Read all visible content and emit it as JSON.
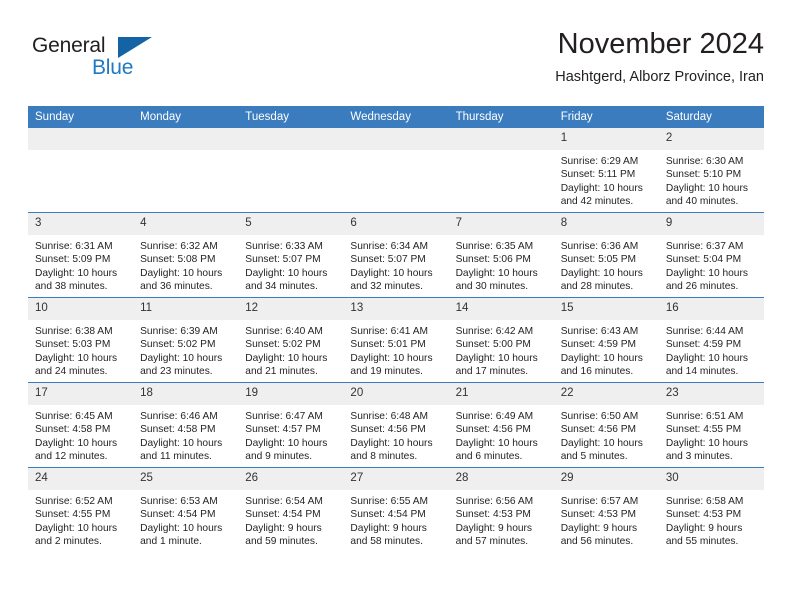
{
  "brand": {
    "name_top": "General",
    "name_bottom": "Blue"
  },
  "header": {
    "title": "November 2024",
    "location": "Hashtgerd, Alborz Province, Iran"
  },
  "colors": {
    "header_blue": "#3a7cbe",
    "brand_blue": "#1f7ac4",
    "daynum_bg": "#efeff0",
    "text": "#231f20"
  },
  "weekdays": [
    "Sunday",
    "Monday",
    "Tuesday",
    "Wednesday",
    "Thursday",
    "Friday",
    "Saturday"
  ],
  "weeks": [
    [
      {
        "day": "",
        "empty": true
      },
      {
        "day": "",
        "empty": true
      },
      {
        "day": "",
        "empty": true
      },
      {
        "day": "",
        "empty": true
      },
      {
        "day": "",
        "empty": true
      },
      {
        "day": "1",
        "sunrise": "Sunrise: 6:29 AM",
        "sunset": "Sunset: 5:11 PM",
        "daylight": "Daylight: 10 hours and 42 minutes."
      },
      {
        "day": "2",
        "sunrise": "Sunrise: 6:30 AM",
        "sunset": "Sunset: 5:10 PM",
        "daylight": "Daylight: 10 hours and 40 minutes."
      }
    ],
    [
      {
        "day": "3",
        "sunrise": "Sunrise: 6:31 AM",
        "sunset": "Sunset: 5:09 PM",
        "daylight": "Daylight: 10 hours and 38 minutes."
      },
      {
        "day": "4",
        "sunrise": "Sunrise: 6:32 AM",
        "sunset": "Sunset: 5:08 PM",
        "daylight": "Daylight: 10 hours and 36 minutes."
      },
      {
        "day": "5",
        "sunrise": "Sunrise: 6:33 AM",
        "sunset": "Sunset: 5:07 PM",
        "daylight": "Daylight: 10 hours and 34 minutes."
      },
      {
        "day": "6",
        "sunrise": "Sunrise: 6:34 AM",
        "sunset": "Sunset: 5:07 PM",
        "daylight": "Daylight: 10 hours and 32 minutes."
      },
      {
        "day": "7",
        "sunrise": "Sunrise: 6:35 AM",
        "sunset": "Sunset: 5:06 PM",
        "daylight": "Daylight: 10 hours and 30 minutes."
      },
      {
        "day": "8",
        "sunrise": "Sunrise: 6:36 AM",
        "sunset": "Sunset: 5:05 PM",
        "daylight": "Daylight: 10 hours and 28 minutes."
      },
      {
        "day": "9",
        "sunrise": "Sunrise: 6:37 AM",
        "sunset": "Sunset: 5:04 PM",
        "daylight": "Daylight: 10 hours and 26 minutes."
      }
    ],
    [
      {
        "day": "10",
        "sunrise": "Sunrise: 6:38 AM",
        "sunset": "Sunset: 5:03 PM",
        "daylight": "Daylight: 10 hours and 24 minutes."
      },
      {
        "day": "11",
        "sunrise": "Sunrise: 6:39 AM",
        "sunset": "Sunset: 5:02 PM",
        "daylight": "Daylight: 10 hours and 23 minutes."
      },
      {
        "day": "12",
        "sunrise": "Sunrise: 6:40 AM",
        "sunset": "Sunset: 5:02 PM",
        "daylight": "Daylight: 10 hours and 21 minutes."
      },
      {
        "day": "13",
        "sunrise": "Sunrise: 6:41 AM",
        "sunset": "Sunset: 5:01 PM",
        "daylight": "Daylight: 10 hours and 19 minutes."
      },
      {
        "day": "14",
        "sunrise": "Sunrise: 6:42 AM",
        "sunset": "Sunset: 5:00 PM",
        "daylight": "Daylight: 10 hours and 17 minutes."
      },
      {
        "day": "15",
        "sunrise": "Sunrise: 6:43 AM",
        "sunset": "Sunset: 4:59 PM",
        "daylight": "Daylight: 10 hours and 16 minutes."
      },
      {
        "day": "16",
        "sunrise": "Sunrise: 6:44 AM",
        "sunset": "Sunset: 4:59 PM",
        "daylight": "Daylight: 10 hours and 14 minutes."
      }
    ],
    [
      {
        "day": "17",
        "sunrise": "Sunrise: 6:45 AM",
        "sunset": "Sunset: 4:58 PM",
        "daylight": "Daylight: 10 hours and 12 minutes."
      },
      {
        "day": "18",
        "sunrise": "Sunrise: 6:46 AM",
        "sunset": "Sunset: 4:58 PM",
        "daylight": "Daylight: 10 hours and 11 minutes."
      },
      {
        "day": "19",
        "sunrise": "Sunrise: 6:47 AM",
        "sunset": "Sunset: 4:57 PM",
        "daylight": "Daylight: 10 hours and 9 minutes."
      },
      {
        "day": "20",
        "sunrise": "Sunrise: 6:48 AM",
        "sunset": "Sunset: 4:56 PM",
        "daylight": "Daylight: 10 hours and 8 minutes."
      },
      {
        "day": "21",
        "sunrise": "Sunrise: 6:49 AM",
        "sunset": "Sunset: 4:56 PM",
        "daylight": "Daylight: 10 hours and 6 minutes."
      },
      {
        "day": "22",
        "sunrise": "Sunrise: 6:50 AM",
        "sunset": "Sunset: 4:56 PM",
        "daylight": "Daylight: 10 hours and 5 minutes."
      },
      {
        "day": "23",
        "sunrise": "Sunrise: 6:51 AM",
        "sunset": "Sunset: 4:55 PM",
        "daylight": "Daylight: 10 hours and 3 minutes."
      }
    ],
    [
      {
        "day": "24",
        "sunrise": "Sunrise: 6:52 AM",
        "sunset": "Sunset: 4:55 PM",
        "daylight": "Daylight: 10 hours and 2 minutes."
      },
      {
        "day": "25",
        "sunrise": "Sunrise: 6:53 AM",
        "sunset": "Sunset: 4:54 PM",
        "daylight": "Daylight: 10 hours and 1 minute."
      },
      {
        "day": "26",
        "sunrise": "Sunrise: 6:54 AM",
        "sunset": "Sunset: 4:54 PM",
        "daylight": "Daylight: 9 hours and 59 minutes."
      },
      {
        "day": "27",
        "sunrise": "Sunrise: 6:55 AM",
        "sunset": "Sunset: 4:54 PM",
        "daylight": "Daylight: 9 hours and 58 minutes."
      },
      {
        "day": "28",
        "sunrise": "Sunrise: 6:56 AM",
        "sunset": "Sunset: 4:53 PM",
        "daylight": "Daylight: 9 hours and 57 minutes."
      },
      {
        "day": "29",
        "sunrise": "Sunrise: 6:57 AM",
        "sunset": "Sunset: 4:53 PM",
        "daylight": "Daylight: 9 hours and 56 minutes."
      },
      {
        "day": "30",
        "sunrise": "Sunrise: 6:58 AM",
        "sunset": "Sunset: 4:53 PM",
        "daylight": "Daylight: 9 hours and 55 minutes."
      }
    ]
  ]
}
